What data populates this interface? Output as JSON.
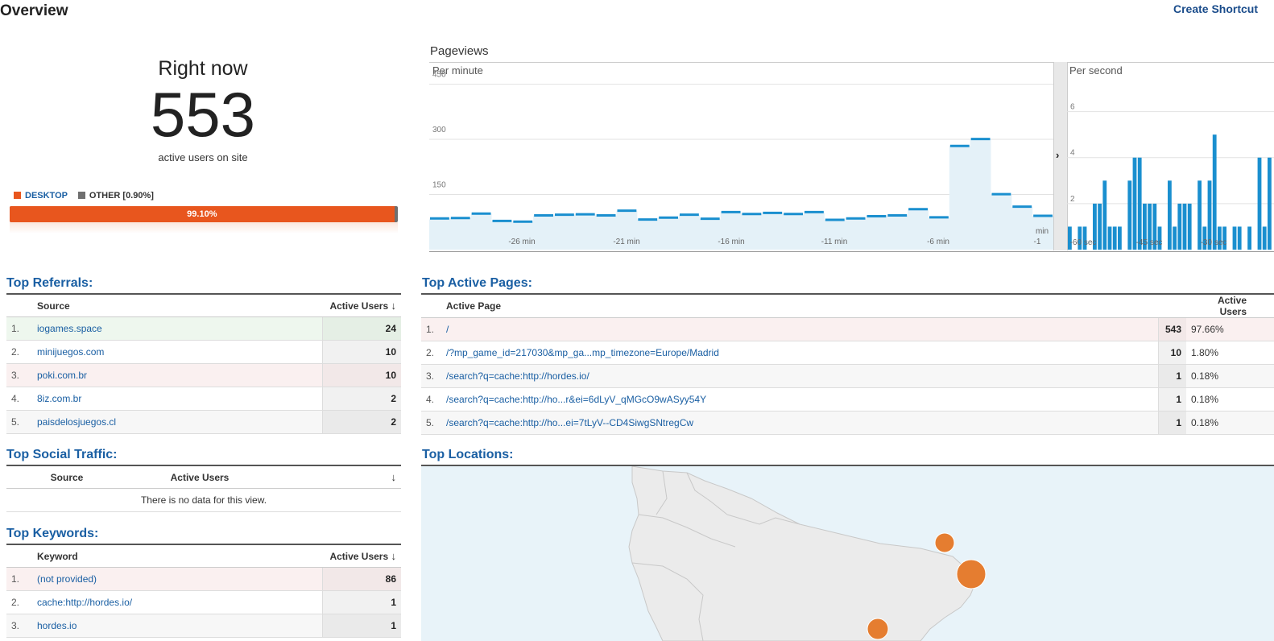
{
  "page": {
    "title": "Overview",
    "create_shortcut": "Create Shortcut"
  },
  "right_now": {
    "label": "Right now",
    "count": "553",
    "sub": "active users on site"
  },
  "devices": {
    "desktop_label": "DESKTOP",
    "other_label": "OTHER [0.90%]",
    "desktop_pct_label": "99.10%",
    "desktop_fraction": 0.991,
    "desktop_color": "#e8561e",
    "other_color": "#6f6f6f"
  },
  "pageviews": {
    "title": "Pageviews",
    "per_minute_label": "Per minute",
    "per_second_label": "Per second"
  },
  "chart_data": [
    {
      "type": "area",
      "name": "Per minute",
      "x_labels": [
        "-26 min",
        "-21 min",
        "-16 min",
        "-11 min",
        "-6 min",
        "-1"
      ],
      "x_unit_label": "min",
      "y_ticks": [
        150,
        300,
        450
      ],
      "ylim": [
        0,
        460
      ],
      "values": [
        85,
        86,
        98,
        78,
        76,
        93,
        95,
        96,
        93,
        106,
        82,
        87,
        95,
        84,
        102,
        97,
        100,
        97,
        102,
        81,
        85,
        91,
        93,
        110,
        88,
        282,
        301,
        151,
        117,
        92
      ],
      "color": "#1a8fcf",
      "fill": "#e4f1f8"
    },
    {
      "type": "bar",
      "name": "Per second",
      "x_labels": [
        "-60 sec",
        "-45 sec",
        "-30 sec"
      ],
      "y_ticks": [
        2,
        4,
        6
      ],
      "ylim": [
        0,
        7
      ],
      "values": [
        1,
        0,
        1,
        1,
        0,
        2,
        2,
        3,
        1,
        1,
        1,
        0,
        3,
        4,
        4,
        2,
        2,
        2,
        1,
        0,
        3,
        1,
        2,
        2,
        2,
        0,
        3,
        1,
        3,
        5,
        1,
        1,
        0,
        1,
        1,
        0,
        1,
        0,
        4,
        1,
        4
      ],
      "color": "#1a8fcf"
    }
  ],
  "referrals": {
    "title": "Top Referrals:",
    "col_source": "Source",
    "col_users": "Active Users",
    "rows": [
      {
        "n": "1.",
        "source": "iogames.space",
        "users": "24"
      },
      {
        "n": "2.",
        "source": "minijuegos.com",
        "users": "10"
      },
      {
        "n": "3.",
        "source": "poki.com.br",
        "users": "10"
      },
      {
        "n": "4.",
        "source": "8iz.com.br",
        "users": "2"
      },
      {
        "n": "5.",
        "source": "paisdelosjuegos.cl",
        "users": "2"
      }
    ]
  },
  "social": {
    "title": "Top Social Traffic:",
    "col_source": "Source",
    "col_users": "Active Users",
    "empty": "There is no data for this view."
  },
  "keywords": {
    "title": "Top Keywords:",
    "col_keyword": "Keyword",
    "col_users": "Active Users",
    "rows": [
      {
        "n": "1.",
        "keyword": "(not provided)",
        "users": "86"
      },
      {
        "n": "2.",
        "keyword": "cache:http://hordes.io/",
        "users": "1"
      },
      {
        "n": "3.",
        "keyword": "hordes.io",
        "users": "1"
      }
    ]
  },
  "pages": {
    "title": "Top Active Pages:",
    "col_page": "Active Page",
    "col_users": "Active Users",
    "rows": [
      {
        "n": "1.",
        "page": "/",
        "users": "543",
        "pct": "97.66%"
      },
      {
        "n": "2.",
        "page": "/?mp_game_id=217030&mp_ga...mp_timezone=Europe/Madrid",
        "users": "10",
        "pct": "1.80%"
      },
      {
        "n": "3.",
        "page": "/search?q=cache:http://hordes.io/",
        "users": "1",
        "pct": "0.18%"
      },
      {
        "n": "4.",
        "page": "/search?q=cache:http://ho...r&ei=6dLyV_qMGcO9wASyy54Y",
        "users": "1",
        "pct": "0.18%"
      },
      {
        "n": "5.",
        "page": "/search?q=cache:http://ho...ei=7tLyV--CD4SiwgSNtregCw",
        "users": "1",
        "pct": "0.18%"
      }
    ]
  },
  "locations": {
    "title": "Top Locations:",
    "map_water_color": "#e8f3f9",
    "map_land_color": "#ebebeb",
    "marker_color": "#e57d30"
  }
}
